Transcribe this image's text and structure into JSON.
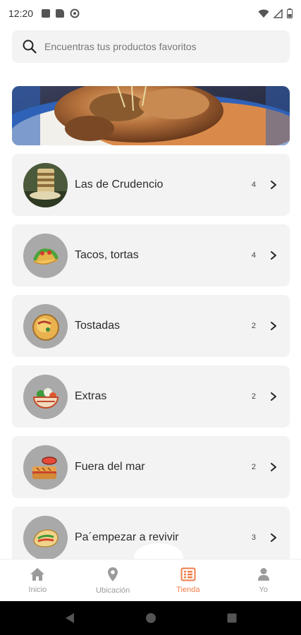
{
  "status_bar": {
    "time": "12:20"
  },
  "search": {
    "placeholder": "Encuentras tus productos favoritos"
  },
  "categories": [
    {
      "name": "Las de Crudencio",
      "count": "4"
    },
    {
      "name": "Tacos, tortas",
      "count": "4"
    },
    {
      "name": "Tostadas",
      "count": "2"
    },
    {
      "name": "Extras",
      "count": "2"
    },
    {
      "name": "Fuera del mar",
      "count": "2"
    },
    {
      "name": "Pa´empezar a revivir",
      "count": "3"
    }
  ],
  "bottom_nav": {
    "items": [
      {
        "label": "Inicio",
        "icon": "home-icon"
      },
      {
        "label": "Ubicación",
        "icon": "location-pin-icon"
      },
      {
        "label": "Tienda",
        "icon": "store-list-icon"
      },
      {
        "label": "Yo",
        "icon": "user-icon"
      }
    ],
    "active_color": "#f07d4a",
    "inactive_color": "#9b9b9b"
  }
}
